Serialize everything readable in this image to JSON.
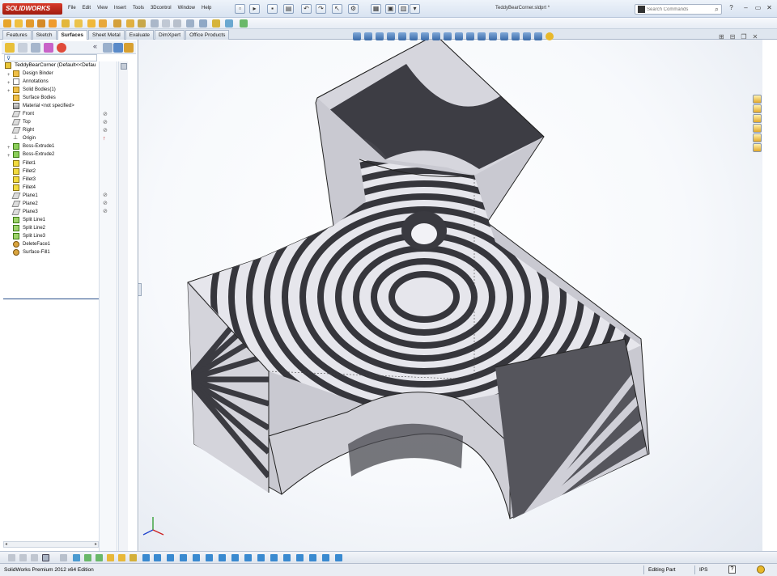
{
  "app": {
    "logo_text": "SOLIDWORKS",
    "document_title": "TeddyBearCorner.sldprt *"
  },
  "menu": [
    "File",
    "Edit",
    "View",
    "Insert",
    "Tools",
    "3Dcontrol",
    "Window",
    "Help"
  ],
  "search": {
    "placeholder": "Search Commands"
  },
  "tabs": [
    {
      "label": "Features",
      "active": false
    },
    {
      "label": "Sketch",
      "active": false
    },
    {
      "label": "Surfaces",
      "active": true
    },
    {
      "label": "Sheet Metal",
      "active": false
    },
    {
      "label": "Evaluate",
      "active": false
    },
    {
      "label": "DimXpert",
      "active": false
    },
    {
      "label": "Office Products",
      "active": false
    }
  ],
  "tree": {
    "root": "TeddyBearCorner  (Default<<Defau",
    "items": [
      {
        "label": "Design Binder",
        "icon": "folder-icon",
        "expand": "+"
      },
      {
        "label": "Annotations",
        "icon": "annotation-icon",
        "expand": "+"
      },
      {
        "label": "Solid Bodies(1)",
        "icon": "solid-bodies-icon",
        "expand": "+"
      },
      {
        "label": "Surface Bodies",
        "icon": "surface-bodies-icon",
        "expand": ""
      },
      {
        "label": "Material <not specified>",
        "icon": "material-icon",
        "expand": ""
      },
      {
        "label": "Front",
        "icon": "plane-icon",
        "expand": ""
      },
      {
        "label": "Top",
        "icon": "plane-icon",
        "expand": ""
      },
      {
        "label": "Right",
        "icon": "plane-icon",
        "expand": ""
      },
      {
        "label": "Origin",
        "icon": "origin-icon",
        "expand": ""
      },
      {
        "label": "Boss-Extrude1",
        "icon": "extrude-icon",
        "expand": "+"
      },
      {
        "label": "Boss-Extrude2",
        "icon": "extrude-icon",
        "expand": "+"
      },
      {
        "label": "Fillet1",
        "icon": "fillet-icon",
        "expand": ""
      },
      {
        "label": "Fillet2",
        "icon": "fillet-icon",
        "expand": ""
      },
      {
        "label": "Fillet3",
        "icon": "fillet-icon",
        "expand": ""
      },
      {
        "label": "Fillet4",
        "icon": "fillet-icon",
        "expand": ""
      },
      {
        "label": "Plane1",
        "icon": "plane-icon",
        "expand": ""
      },
      {
        "label": "Plane2",
        "icon": "plane-icon",
        "expand": ""
      },
      {
        "label": "Plane3",
        "icon": "plane-icon",
        "expand": ""
      },
      {
        "label": "Split Line1",
        "icon": "split-line-icon",
        "expand": ""
      },
      {
        "label": "Split Line2",
        "icon": "split-line-icon",
        "expand": ""
      },
      {
        "label": "Split Line3",
        "icon": "split-line-icon",
        "expand": ""
      },
      {
        "label": "DeleteFace1",
        "icon": "delete-face-icon",
        "expand": ""
      },
      {
        "label": "Surface-Fill1",
        "icon": "surface-fill-icon",
        "expand": ""
      }
    ]
  },
  "status": {
    "product": "SolidWorks Premium 2012 x64 Edition",
    "mode": "Editing Part",
    "units": "IPS",
    "help_glyph": "?"
  },
  "colors": {
    "zebra_dark": "#3b3b40",
    "zebra_light": "#d9d9e0",
    "tree_accent": "#2a4f8a"
  }
}
